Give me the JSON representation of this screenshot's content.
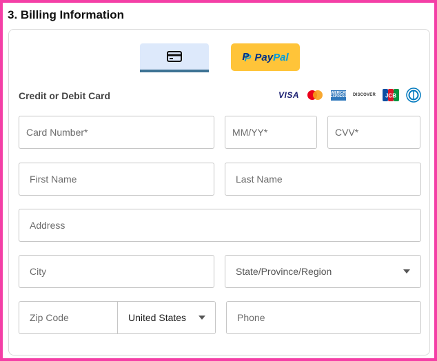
{
  "section": {
    "title": "3. Billing Information"
  },
  "payment_tabs": {
    "card_icon": "credit-card-icon",
    "paypal_label_1": "Pay",
    "paypal_label_2": "Pal",
    "paypal_mark": "P"
  },
  "card_section": {
    "label": "Credit or Debit Card",
    "brands": {
      "visa": "VISA",
      "amex": "AMERICAN EXPRESS",
      "discover": "DISCOVER",
      "jcb": "JCB"
    }
  },
  "fields": {
    "card_number": {
      "placeholder": "Card Number*"
    },
    "expiry": {
      "placeholder": "MM/YY*"
    },
    "cvv": {
      "placeholder": "CVV*"
    },
    "first_name": {
      "placeholder": "First Name"
    },
    "last_name": {
      "placeholder": "Last Name"
    },
    "address": {
      "placeholder": "Address"
    },
    "city": {
      "placeholder": "City"
    },
    "state": {
      "placeholder": "State/Province/Region"
    },
    "zip": {
      "placeholder": "Zip Code"
    },
    "country": {
      "value": "United States"
    },
    "phone": {
      "placeholder": "Phone"
    }
  },
  "colors": {
    "frame_border": "#f43fa6",
    "active_tab_bg": "#dde9fb",
    "active_tab_underline": "#3e7394",
    "paypal_bg": "#ffc439",
    "mastercard_red": "#eb001b",
    "mastercard_orange": "#f79e1b"
  }
}
